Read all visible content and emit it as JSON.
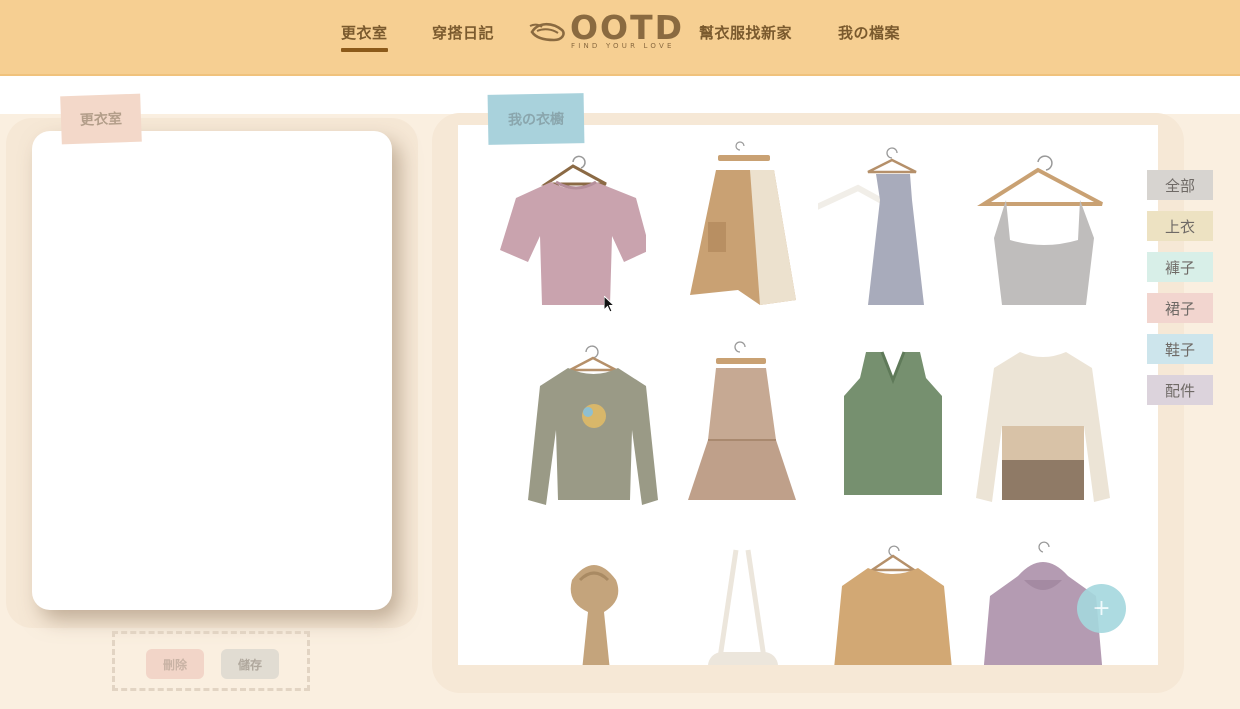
{
  "nav": {
    "items": [
      {
        "label": "更衣室",
        "active": true
      },
      {
        "label": "穿搭日記",
        "active": false
      },
      {
        "label": "幫衣服找新家",
        "active": false
      },
      {
        "label": "我の檔案",
        "active": false
      }
    ],
    "logo_text": "OOTD",
    "logo_tagline": "FIND YOUR LOVE"
  },
  "fitting_room": {
    "tag": "更衣室",
    "delete_label": "刪除",
    "save_label": "儲存"
  },
  "closet": {
    "tag": "我の衣櫥",
    "items": [
      {
        "name": "pink-cropped-tshirt",
        "icon": "tshirt-icon",
        "color": "#c9a3ae"
      },
      {
        "name": "khaki-asymmetric-skirt",
        "icon": "skirt-icon",
        "color": "#c9a173"
      },
      {
        "name": "grey-slip-dress",
        "icon": "dress-icon",
        "color": "#a8abbb"
      },
      {
        "name": "grey-camisole",
        "icon": "camisole-icon",
        "color": "#bfbdbc"
      },
      {
        "name": "olive-graphic-sweatshirt",
        "icon": "sweatshirt-icon",
        "color": "#9a9a86"
      },
      {
        "name": "plaid-tiered-skirt",
        "icon": "skirt-icon",
        "color": "#c6a993"
      },
      {
        "name": "green-knit-vest",
        "icon": "vest-icon",
        "color": "#76906f"
      },
      {
        "name": "colorblock-sweater",
        "icon": "sweater-icon",
        "color": "#d8c2a7"
      },
      {
        "name": "knit-scarf",
        "icon": "scarf-icon",
        "color": "#c4a47c"
      },
      {
        "name": "cream-crossbody-bag",
        "icon": "bag-icon",
        "color": "#ece6dc"
      },
      {
        "name": "camel-sweatshirt",
        "icon": "sweatshirt-icon",
        "color": "#d2a874"
      },
      {
        "name": "lilac-hoodie",
        "icon": "hoodie-icon",
        "color": "#b49bb2"
      }
    ]
  },
  "categories": [
    {
      "label": "全部",
      "color": "#d7d4d0"
    },
    {
      "label": "上衣",
      "color": "#ede2c2"
    },
    {
      "label": "褲子",
      "color": "#d8efe8"
    },
    {
      "label": "裙子",
      "color": "#f2d5cf"
    },
    {
      "label": "鞋子",
      "color": "#cde5ec"
    },
    {
      "label": "配件",
      "color": "#dcd3dc"
    }
  ],
  "add_label": "+"
}
